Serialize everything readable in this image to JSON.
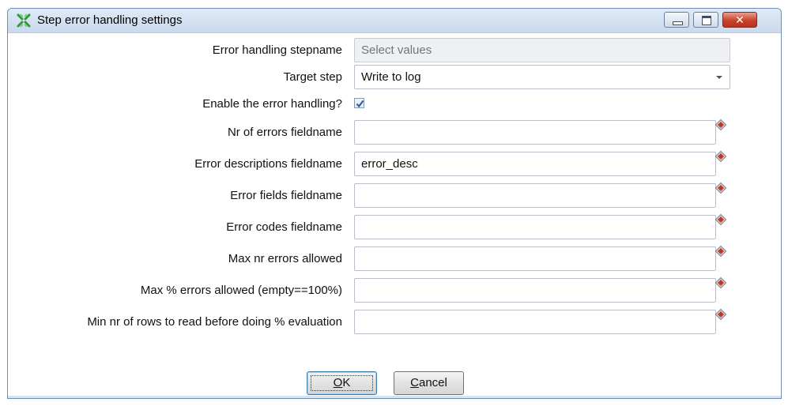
{
  "window": {
    "title": "Step error handling settings"
  },
  "form": {
    "stepname": {
      "label": "Error handling stepname",
      "value": "",
      "placeholder": "Select values"
    },
    "target_step": {
      "label": "Target step",
      "value": "Write to log"
    },
    "enable": {
      "label": "Enable the error handling?",
      "checked": true
    },
    "nr_errors_field": {
      "label": "Nr of errors fieldname",
      "value": ""
    },
    "error_desc_field": {
      "label": "Error descriptions fieldname",
      "value": "error_desc"
    },
    "error_fields_field": {
      "label": "Error fields fieldname",
      "value": ""
    },
    "error_codes_field": {
      "label": "Error codes fieldname",
      "value": ""
    },
    "max_nr_errors": {
      "label": "Max nr errors allowed",
      "value": ""
    },
    "max_pct_errors": {
      "label": "Max % errors allowed (empty==100%)",
      "value": ""
    },
    "min_rows": {
      "label": "Min nr of rows to read before doing % evaluation",
      "value": ""
    }
  },
  "buttons": {
    "ok": {
      "mnemonic": "O",
      "rest": "K"
    },
    "cancel": {
      "mnemonic": "C",
      "rest": "ancel"
    }
  },
  "icons": {
    "title_icon": "kettle-spoon-icon",
    "variable_icon": "variable-diamond-icon",
    "checkmark": "checkmark-icon"
  },
  "colors": {
    "titlebar": "#cad9ec",
    "close_button": "#c8432a",
    "variable_icon": "#c0392b",
    "checkmark": "#2f5b9a"
  }
}
